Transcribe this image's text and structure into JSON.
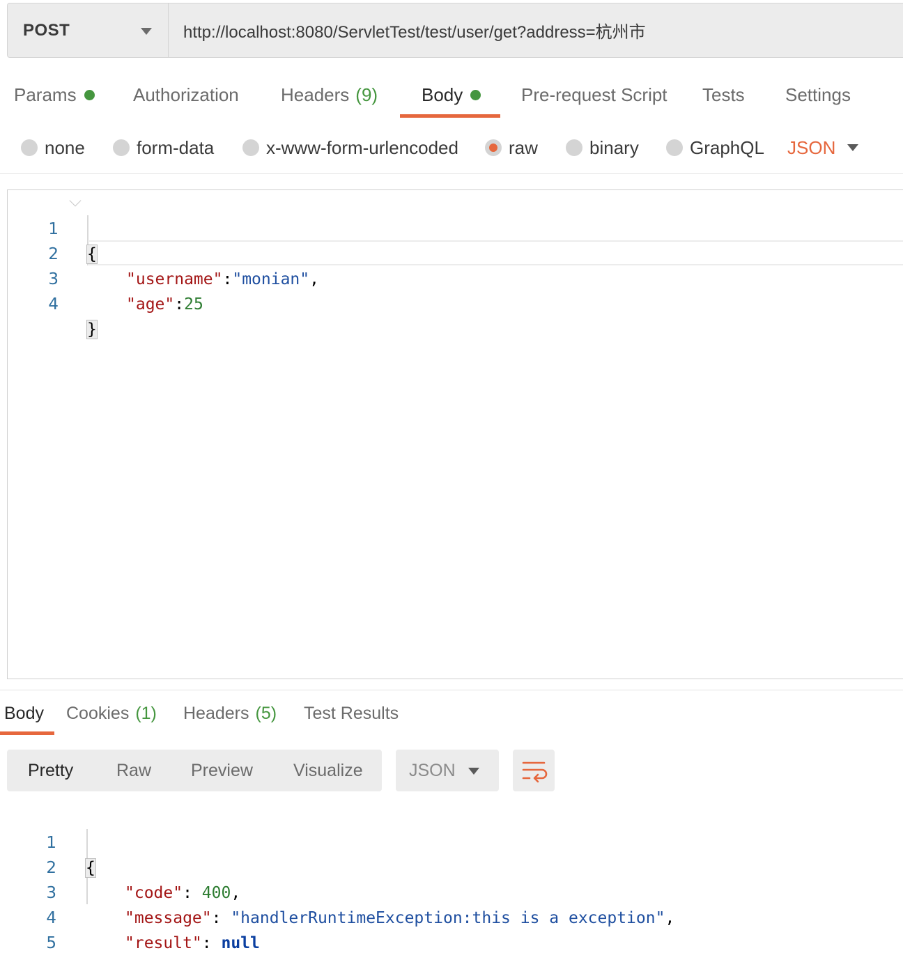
{
  "request": {
    "method": "POST",
    "url": "http://localhost:8080/ServletTest/test/user/get?address=杭州市"
  },
  "request_tabs": [
    {
      "label": "Params",
      "dot": true
    },
    {
      "label": "Authorization"
    },
    {
      "label": "Headers",
      "count": "(9)"
    },
    {
      "label": "Body",
      "dot": true,
      "active": true
    },
    {
      "label": "Pre-request Script"
    },
    {
      "label": "Tests"
    },
    {
      "label": "Settings"
    }
  ],
  "body_types": [
    "none",
    "form-data",
    "x-www-form-urlencoded",
    "raw",
    "binary",
    "GraphQL"
  ],
  "body_type_selected": "raw",
  "body_language": "JSON",
  "request_body_lines": [
    "1",
    "2",
    "3",
    "4"
  ],
  "request_body": {
    "open": "{",
    "l2_key": "\"username\"",
    "l2_colon": ":",
    "l2_val": "\"monian\"",
    "l2_comma": ",",
    "l3_key": "\"age\"",
    "l3_colon": ":",
    "l3_val": "25",
    "close": "}"
  },
  "response_tabs": [
    {
      "label": "Body",
      "active": true
    },
    {
      "label": "Cookies",
      "count": "(1)"
    },
    {
      "label": "Headers",
      "count": "(5)"
    },
    {
      "label": "Test Results"
    }
  ],
  "response_views": [
    "Pretty",
    "Raw",
    "Preview",
    "Visualize"
  ],
  "response_view_selected": "Pretty",
  "response_format": "JSON",
  "response_body_lines": [
    "1",
    "2",
    "3",
    "4",
    "5"
  ],
  "response_body": {
    "open": "{",
    "code_key": "\"code\"",
    "code_val": "400",
    "message_key": "\"message\"",
    "message_val": "\"handlerRuntimeException:this is a exception\"",
    "result_key": "\"result\"",
    "result_val": "null",
    "close": "}"
  },
  "colors": {
    "accent": "#e6673d",
    "green": "#45963f",
    "json_key": "#a31515",
    "json_string": "#1f4fa0",
    "json_number": "#2e7d32"
  }
}
